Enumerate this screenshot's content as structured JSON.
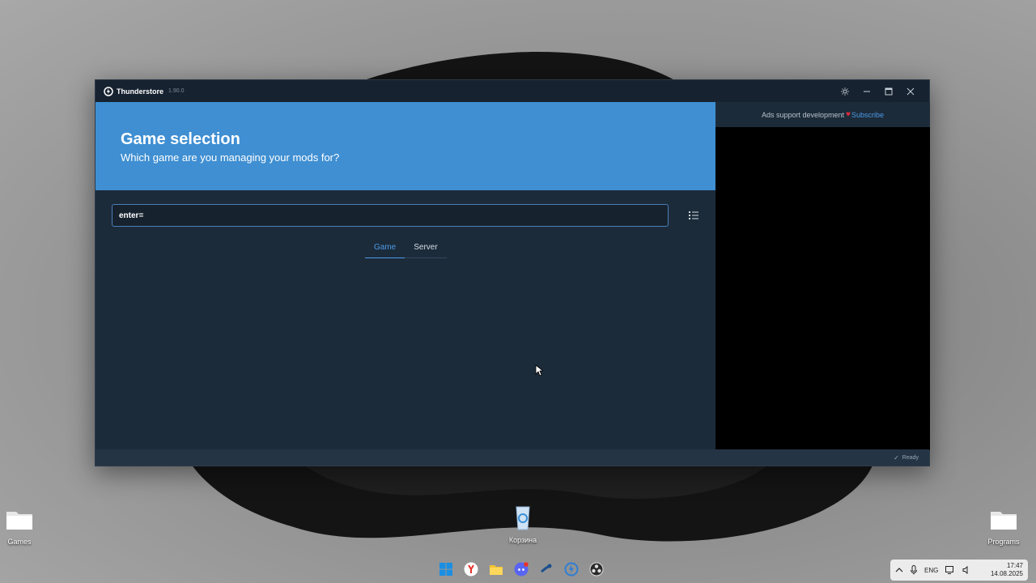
{
  "window": {
    "app_name": "Thunderstore",
    "version": "1.90.0"
  },
  "hero": {
    "title": "Game selection",
    "subtitle": "Which game are you managing your mods for?"
  },
  "search": {
    "value": "enter="
  },
  "tabs": [
    {
      "label": "Game",
      "active": true
    },
    {
      "label": "Server",
      "active": false
    }
  ],
  "ad": {
    "text": "Ads support development",
    "subscribe": "Subscribe"
  },
  "status": {
    "text": "Ready"
  },
  "desktop": {
    "icons": [
      {
        "label": "Games"
      },
      {
        "label": "Корзина"
      },
      {
        "label": "Programs"
      }
    ]
  },
  "taskbar": {
    "items": [
      "windows-start-icon",
      "yandex-browser-icon",
      "file-explorer-icon",
      "discord-icon",
      "steam-icon",
      "thunderstore-icon",
      "obs-icon"
    ]
  },
  "tray": {
    "language": "ENG",
    "time": "17:47",
    "date": "14.08.2025"
  },
  "colors": {
    "accent": "#3f8fd2",
    "window_bg": "#1c2b3a",
    "link": "#4d9ae6"
  }
}
